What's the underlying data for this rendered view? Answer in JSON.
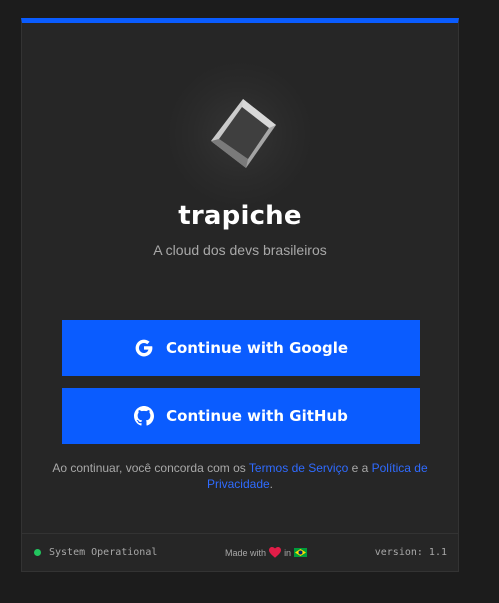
{
  "brand": {
    "name": "trapiche",
    "tagline": "A cloud dos devs brasileiros"
  },
  "buttons": {
    "google": "Continue with Google",
    "github": "Continue with GitHub"
  },
  "terms": {
    "prefix": "Ao continuar, você concorda com os ",
    "terms_link": "Termos de Serviço",
    "middle": " e a ",
    "privacy_link": "Política de Privacidade",
    "suffix": "."
  },
  "footer": {
    "status": "System Operational",
    "made_prefix": "Made with",
    "made_in": "in",
    "version": "version: 1.1"
  },
  "colors": {
    "accent": "#0a5cff",
    "status": "#22c55e",
    "heart": "#e11d48"
  },
  "icons": {
    "logo": "cube-logo-icon",
    "google": "google-icon",
    "github": "github-icon",
    "heart": "heart-icon",
    "flag": "brazil-flag-icon"
  }
}
